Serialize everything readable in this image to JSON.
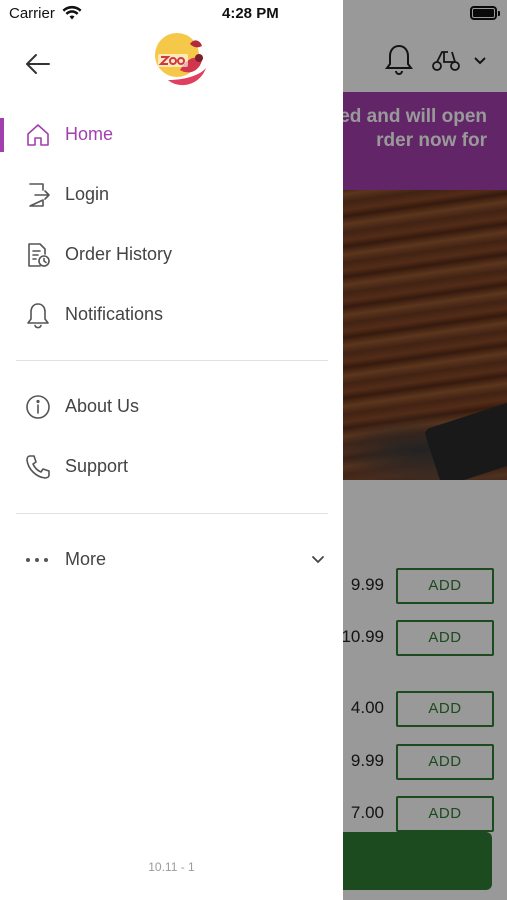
{
  "status_bar": {
    "carrier": "Carrier",
    "time": "4:28 PM"
  },
  "drawer": {
    "nav": [
      {
        "label": "Home",
        "icon": "home-icon",
        "active": true
      },
      {
        "label": "Login",
        "icon": "login-icon",
        "active": false
      },
      {
        "label": "Order History",
        "icon": "order-history-icon",
        "active": false
      },
      {
        "label": "Notifications",
        "icon": "bell-icon",
        "active": false
      }
    ],
    "nav2": [
      {
        "label": "About Us",
        "icon": "info-icon"
      },
      {
        "label": "Support",
        "icon": "phone-icon"
      }
    ],
    "more": {
      "label": "More",
      "icon": "more-dots-icon"
    },
    "version": "10.11 - 1"
  },
  "background": {
    "banner_line1": "ed and will open",
    "banner_line2": "rder now for",
    "menu": [
      {
        "price": "9.99",
        "button": "ADD"
      },
      {
        "price": "10.99",
        "button": "ADD"
      },
      {
        "price": "4.00",
        "button": "ADD"
      },
      {
        "price": "9.99",
        "button": "ADD"
      },
      {
        "price": "7.00",
        "button": "ADD"
      }
    ]
  },
  "colors": {
    "accent": "#a23fae",
    "add_green": "#2e7d32",
    "overlay": "rgba(0,0,0,0.40)"
  }
}
